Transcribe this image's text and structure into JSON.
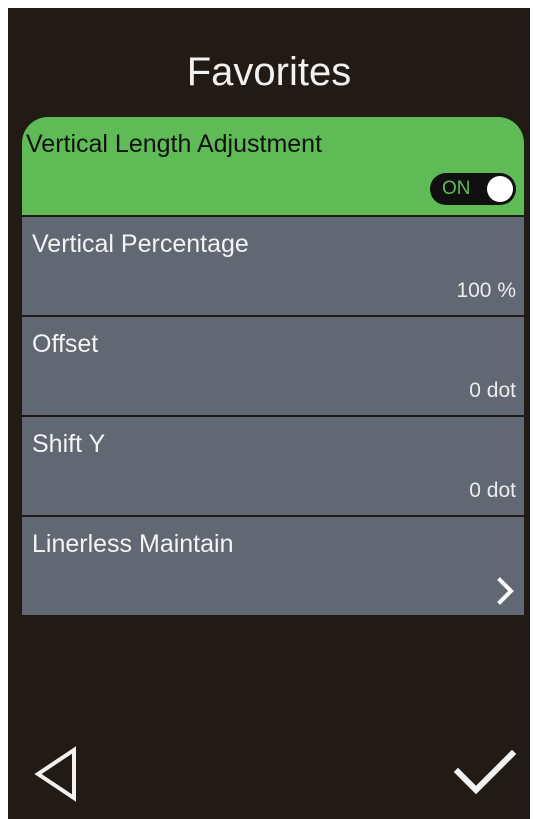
{
  "header": {
    "title": "Favorites"
  },
  "items": [
    {
      "label": "Vertical Length Adjustment",
      "toggle": "ON",
      "active": true
    },
    {
      "label": "Vertical Percentage",
      "value": "100 %"
    },
    {
      "label": "Offset",
      "value": "0 dot"
    },
    {
      "label": "Shift Y",
      "value": "0 dot"
    },
    {
      "label": "Linerless Maintain",
      "icon": "chevron-right-icon"
    }
  ],
  "nav": {
    "back_icon": "back-triangle-icon",
    "confirm_icon": "checkmark-icon"
  },
  "colors": {
    "background": "#221a14",
    "item_bg": "#626774",
    "active_bg": "#5fbb56",
    "text": "#f4f4f4"
  }
}
